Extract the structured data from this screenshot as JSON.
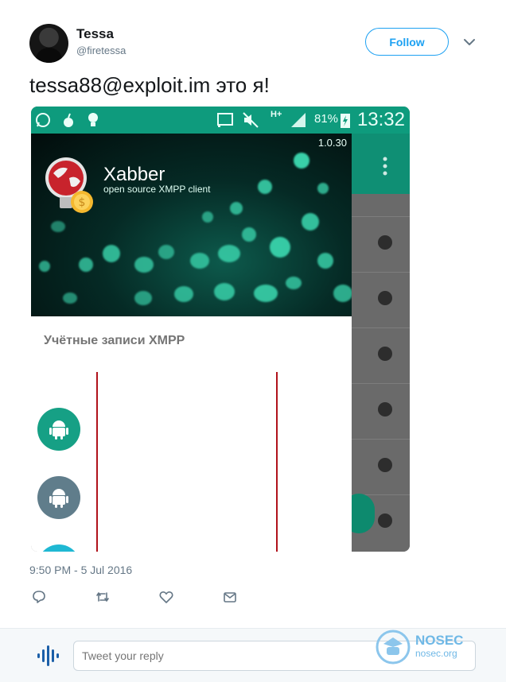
{
  "author": {
    "name": "Tessa",
    "handle": "@firetessa"
  },
  "follow_label": "Follow",
  "tweet_text": "tessa88@exploit.im это я!",
  "screenshot": {
    "status": {
      "network": "H+",
      "battery": "81%",
      "time": "13:32"
    },
    "drawer": {
      "version": "1.0.30",
      "app_name": "Xabber",
      "app_subtitle": "open source XMPP client",
      "section_title": "Учётные записи XMPP",
      "accounts": [
        {
          "color": "#16a085",
          "icon": "android-icon"
        },
        {
          "color": "#607d8b",
          "icon": "android-icon"
        },
        {
          "color": "#1fb8d3",
          "icon": "android-icon"
        }
      ]
    }
  },
  "timestamp": "9:50 PM - 5 Jul 2016",
  "actions": [
    "reply-icon",
    "retweet-icon",
    "like-icon",
    "message-icon"
  ],
  "reply": {
    "placeholder": "Tweet your reply"
  },
  "watermark": {
    "name": "NOSEC",
    "url": "nosec.org"
  },
  "colors": {
    "accent": "#1da1f2",
    "xabber_green": "#0e9b7d",
    "muted": "#657786"
  }
}
